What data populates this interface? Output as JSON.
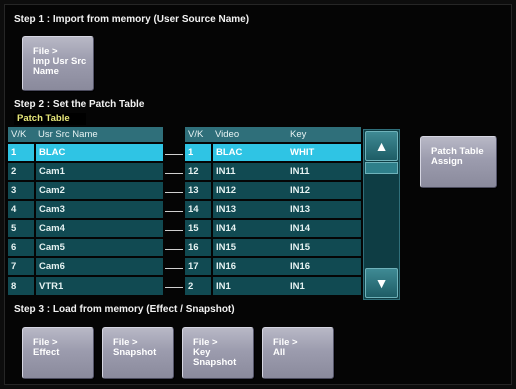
{
  "step1": {
    "label": "Step 1 : Import from memory (User Source Name)",
    "button": "File >\nImp Usr Src\nName"
  },
  "step2": {
    "label": "Step 2 : Set the Patch Table",
    "caption": "Patch Table"
  },
  "left_table": {
    "headers": [
      "V/K",
      "Usr Src Name"
    ],
    "rows": [
      [
        "1",
        "BLAC"
      ],
      [
        "2",
        "Cam1"
      ],
      [
        "3",
        "Cam2"
      ],
      [
        "4",
        "Cam3"
      ],
      [
        "5",
        "Cam4"
      ],
      [
        "6",
        "Cam5"
      ],
      [
        "7",
        "Cam6"
      ],
      [
        "8",
        "VTR1"
      ]
    ],
    "selected_row": 0
  },
  "right_table": {
    "headers": [
      "V/K",
      "Video",
      "Key"
    ],
    "rows": [
      [
        "1",
        "BLAC",
        "WHIT"
      ],
      [
        "12",
        "IN11",
        "IN11"
      ],
      [
        "13",
        "IN12",
        "IN12"
      ],
      [
        "14",
        "IN13",
        "IN13"
      ],
      [
        "15",
        "IN14",
        "IN14"
      ],
      [
        "16",
        "IN15",
        "IN15"
      ],
      [
        "17",
        "IN16",
        "IN16"
      ],
      [
        "2",
        "IN1",
        "IN1"
      ]
    ],
    "selected_row": 0
  },
  "scroll": {
    "up_icon": "▲",
    "down_icon": "▼"
  },
  "patch_assign_button": "Patch Table\nAssign",
  "step3": {
    "label": "Step 3 : Load from memory (Effect / Snapshot)",
    "buttons": [
      "File >\nEffect",
      "File >\nSnapshot",
      "File >\nKey\nSnapshot",
      "File >\nAll"
    ]
  },
  "colors": {
    "row_bg": "#114a52",
    "header_bg": "#2f6f7a",
    "selected_bg": "#2fc4e4",
    "caption_text": "#e8e87a"
  }
}
